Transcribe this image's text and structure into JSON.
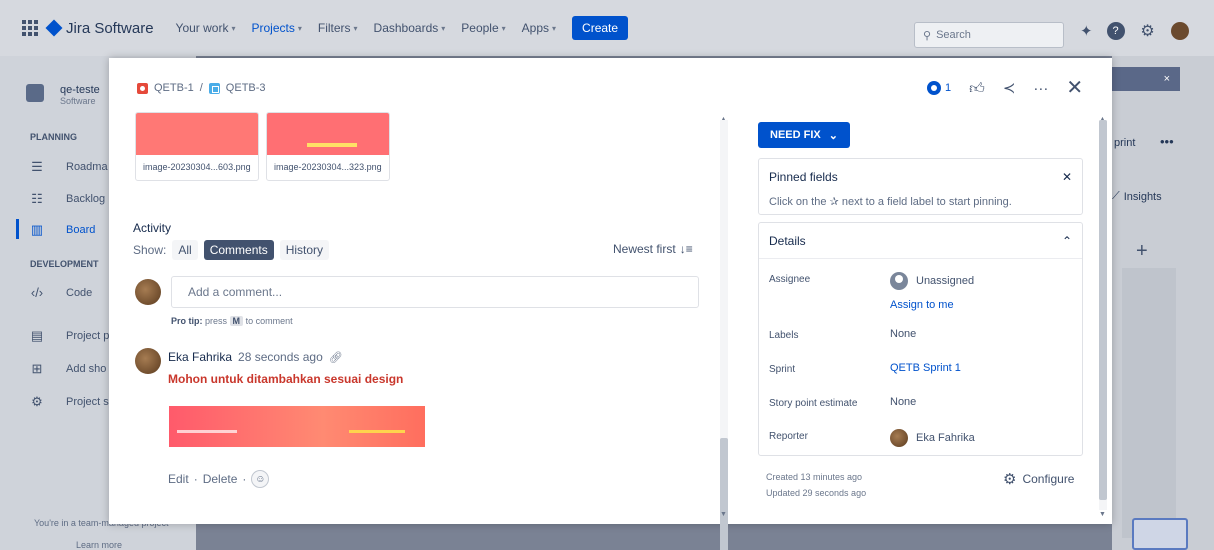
{
  "app": {
    "name": "Jira Software"
  },
  "nav": {
    "items": [
      {
        "label": "Your work"
      },
      {
        "label": "Projects"
      },
      {
        "label": "Filters"
      },
      {
        "label": "Dashboards"
      },
      {
        "label": "People"
      },
      {
        "label": "Apps"
      }
    ],
    "create_label": "Create",
    "search_placeholder": "Search"
  },
  "sidebar": {
    "project_name": "qe-teste",
    "project_type": "Software",
    "planning_label": "PLANNING",
    "development_label": "DEVELOPMENT",
    "items": [
      {
        "label": "Roadma"
      },
      {
        "label": "Backlog"
      },
      {
        "label": "Board"
      },
      {
        "label": "Code"
      },
      {
        "label": "Project p"
      },
      {
        "label": "Add sho"
      },
      {
        "label": "Project s"
      }
    ],
    "footer_text": "You're in a team-managed project",
    "learn_more": "Learn more"
  },
  "board_bg": {
    "sprint_label": "print",
    "more_label": "•••",
    "insights_label": "Insights",
    "banner_close": "×"
  },
  "issue": {
    "parent_key": "QETB-1",
    "separator": "/",
    "key": "QETB-3",
    "watch_count": "1",
    "attachments": [
      {
        "name": "image-20230304...603.png"
      },
      {
        "name": "image-20230304...323.png"
      }
    ],
    "activity": {
      "title": "Activity",
      "show_label": "Show:",
      "filters": [
        "All",
        "Comments",
        "History"
      ],
      "sort_label": "Newest first",
      "comment_placeholder": "Add a comment...",
      "protip_prefix": "Pro tip:",
      "protip_press": "press",
      "protip_key": "M",
      "protip_suffix": "to comment",
      "comment": {
        "author": "Eka Fahrika",
        "time": "28 seconds ago",
        "text": "Mohon untuk ditambahkan sesuai design",
        "edit_label": "Edit",
        "dot": "·",
        "delete_label": "Delete"
      }
    },
    "status": "NEED FIX",
    "pinned": {
      "title": "Pinned fields",
      "hint_before": "Click on the",
      "hint_after": "next to a field label to start pinning."
    },
    "details": {
      "title": "Details",
      "fields": {
        "assignee_label": "Assignee",
        "assignee_value": "Unassigned",
        "assign_to_me": "Assign to me",
        "labels_label": "Labels",
        "labels_value": "None",
        "sprint_label": "Sprint",
        "sprint_value": "QETB Sprint 1",
        "story_label": "Story point estimate",
        "story_value": "None",
        "reporter_label": "Reporter",
        "reporter_value": "Eka Fahrika"
      }
    },
    "created": "Created 13 minutes ago",
    "updated": "Updated 29 seconds ago",
    "configure_label": "Configure"
  }
}
